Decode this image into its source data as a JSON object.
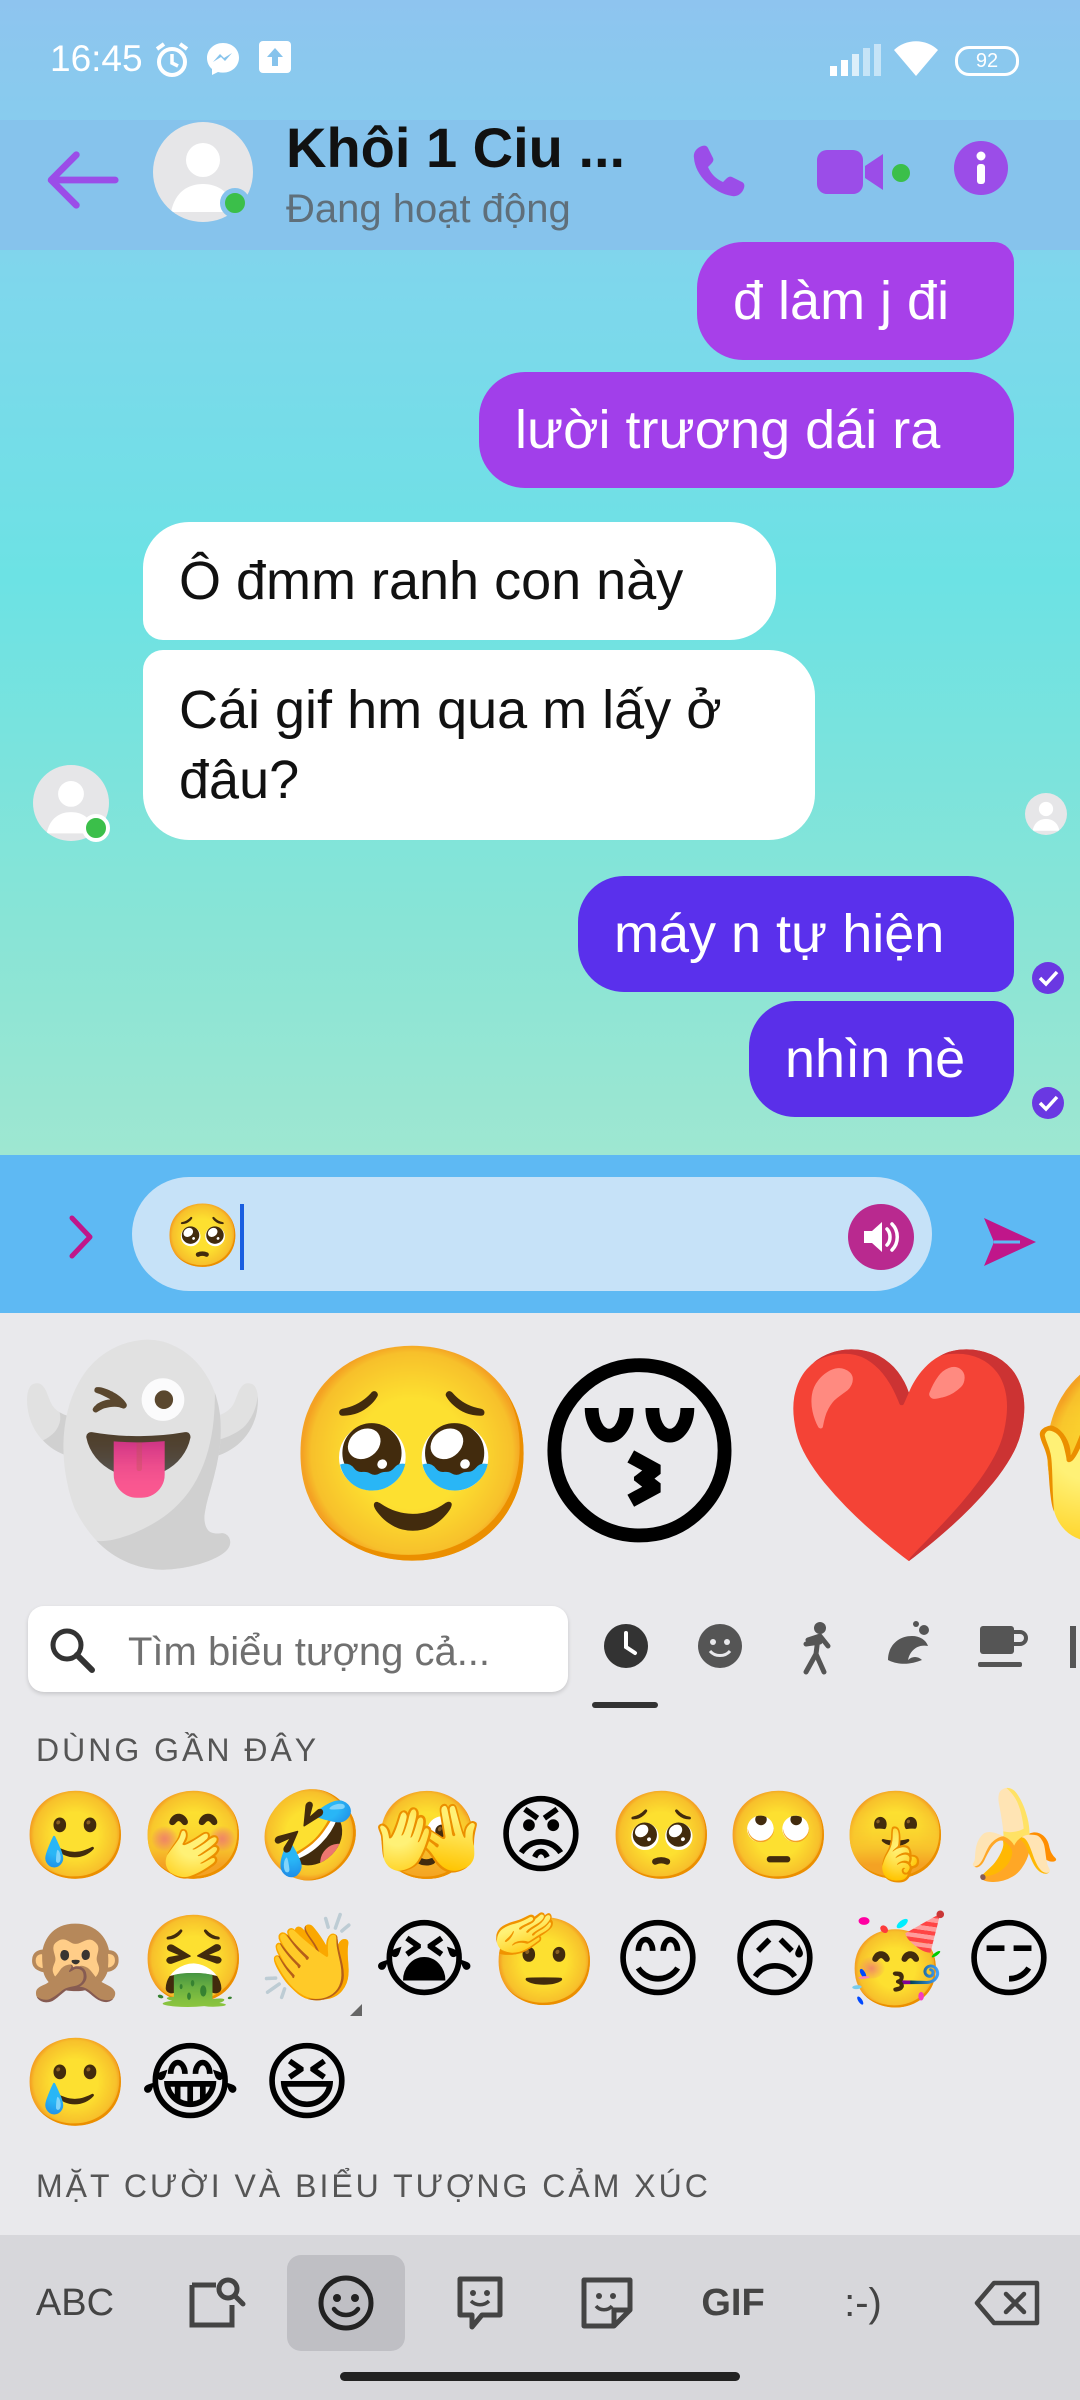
{
  "status_bar": {
    "time": "16:45",
    "battery": "92"
  },
  "header": {
    "name": "Khôi 1 Ciu ...",
    "status": "Đang hoạt động"
  },
  "messages": [
    {
      "text": "đ làm j đi",
      "direction": "outgoing"
    },
    {
      "text": "lười trương dái ra",
      "direction": "outgoing"
    },
    {
      "text": "Ô đmm ranh con này",
      "direction": "incoming"
    },
    {
      "text": "Cái gif hm qua m lấy ở đâu?",
      "direction": "incoming"
    },
    {
      "text": "máy n tự hiện",
      "direction": "outgoing"
    },
    {
      "text": "nhìn nè",
      "direction": "outgoing"
    }
  ],
  "composer": {
    "value": "🥺"
  },
  "keyboard": {
    "suggestions": [
      "👻",
      "🥹",
      "😚",
      "❤️",
      "🫣"
    ],
    "search_placeholder": "Tìm biểu tượng cả...",
    "recent_title": "DÙNG GẦN ĐÂY",
    "recent": [
      "🥲",
      "🤭",
      "🤣",
      "🫣",
      "😡",
      "🥺",
      "🙄",
      "🤫",
      "🍌",
      "🙊",
      "🤮",
      "👏",
      "😭",
      "🫡",
      "😊",
      "😥",
      "🥳",
      "😏",
      "🥲",
      "😂",
      "😆"
    ],
    "smileys_title": "MẶT CƯỜI VÀ BIỂU TƯỢNG CẢM XÚC",
    "bottom_keys": {
      "abc": "ABC",
      "gif": "GIF",
      "emoticon": ":-)"
    }
  },
  "colors": {
    "accent": "#9b4de8",
    "outgoing_top": "#a541e8",
    "outgoing_bottom": "#5b2eea",
    "online": "#3bbf4a"
  }
}
